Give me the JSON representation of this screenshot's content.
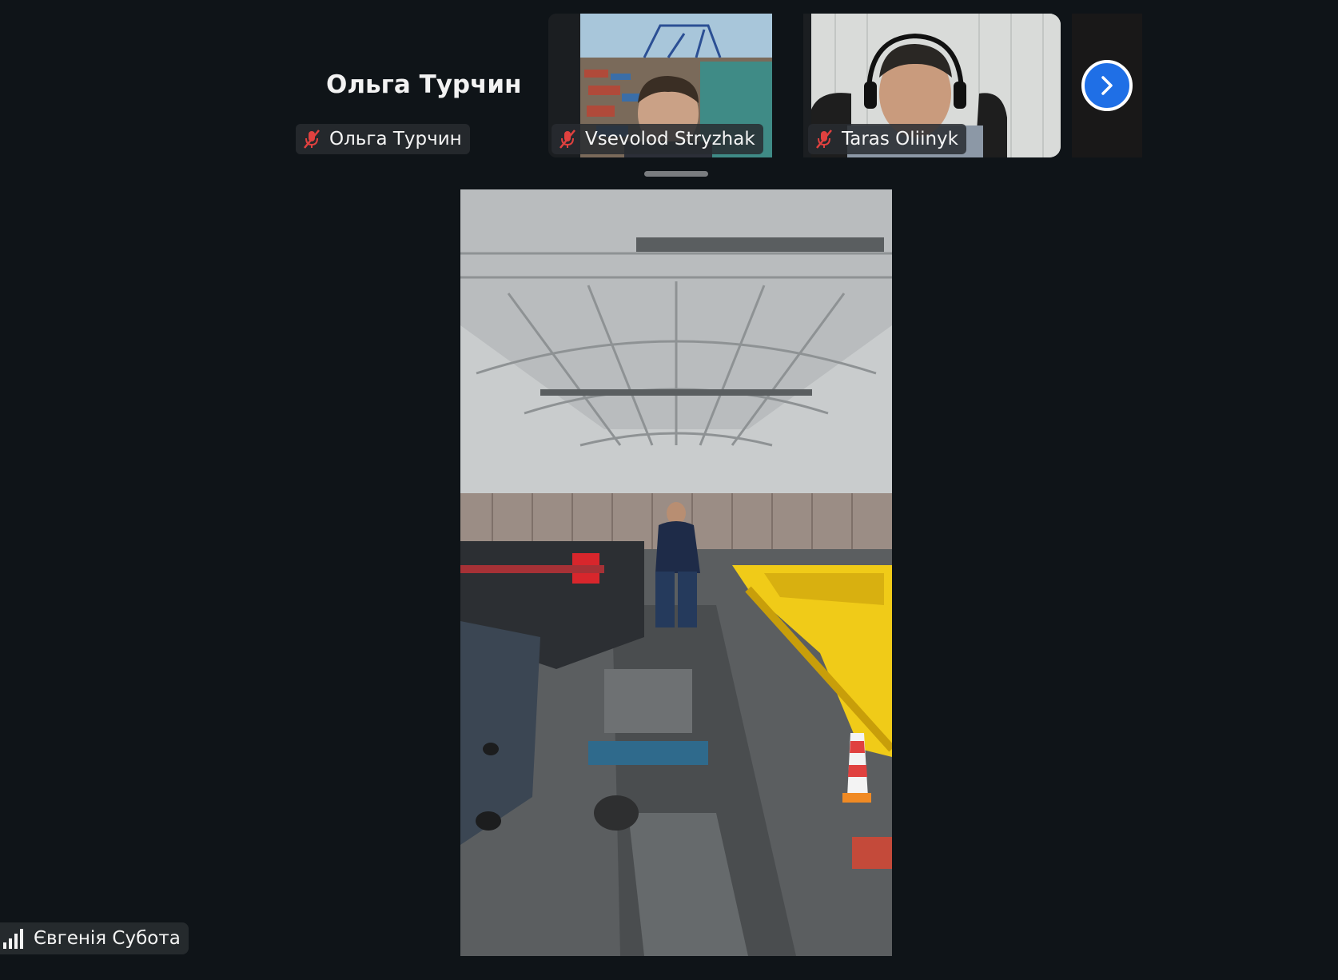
{
  "gallery": {
    "active_speaker_name": "Ольга Турчин",
    "participants": [
      {
        "name": "Ольга Турчин",
        "muted": true
      },
      {
        "name": "Vsevolod Stryzhak",
        "muted": true
      },
      {
        "name": "Taras Oliinyk",
        "muted": true
      }
    ],
    "next_button_icon": "chevron-right-icon"
  },
  "main_view": {
    "self_view_name": "Євгенія Субота",
    "connection_icon": "signal-bars-icon"
  },
  "colors": {
    "background": "#0f1418",
    "muted_icon": "#e0413f",
    "next_button": "#1f6fe6"
  }
}
